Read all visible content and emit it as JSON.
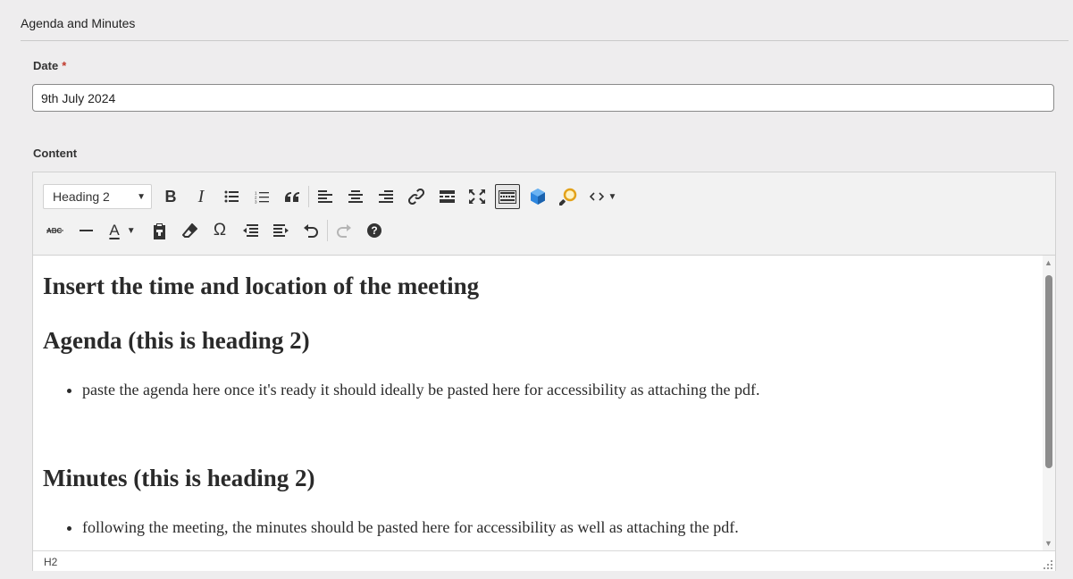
{
  "section": {
    "title": "Agenda and Minutes"
  },
  "date_field": {
    "label": "Date",
    "required_mark": "*",
    "value": "9th July 2024"
  },
  "content_field": {
    "label": "Content"
  },
  "toolbar": {
    "style_select": "Heading 2",
    "row1": [
      "bold-icon",
      "italic-icon",
      "bulleted-list-icon",
      "numbered-list-icon",
      "blockquote-icon",
      "align-left-icon",
      "align-center-icon",
      "align-right-icon",
      "link-icon",
      "horizontal-line-icon",
      "fullscreen-icon",
      "keyboard-icon",
      "cube-icon",
      "search-replace-icon",
      "source-code-icon"
    ],
    "row2": [
      "strikethrough-icon",
      "remove-format-icon",
      "text-color-icon",
      "paste-icon",
      "eraser-icon",
      "omega-icon",
      "outdent-icon",
      "indent-icon",
      "undo-icon",
      "redo-icon",
      "help-icon"
    ],
    "bold": "B",
    "italic": "I",
    "omega": "Ω",
    "help": "?",
    "text_color": "A"
  },
  "editor": {
    "heading1": "Insert the time and location of the meeting",
    "heading2": "Agenda (this is heading 2)",
    "bullet1": "paste the agenda here once it's ready it should ideally be pasted here for accessibility as attaching the pdf.",
    "heading3": "Minutes (this is heading 2)",
    "bullet2": "following the meeting, the minutes should be pasted here for accessibility as well as attaching the pdf."
  },
  "status_bar": {
    "path": "H2"
  },
  "colors": {
    "background": "#eeedee",
    "required": "#c0392b",
    "cube_blue": "#2e86de",
    "magnifier_orange": "#e3a21a"
  }
}
